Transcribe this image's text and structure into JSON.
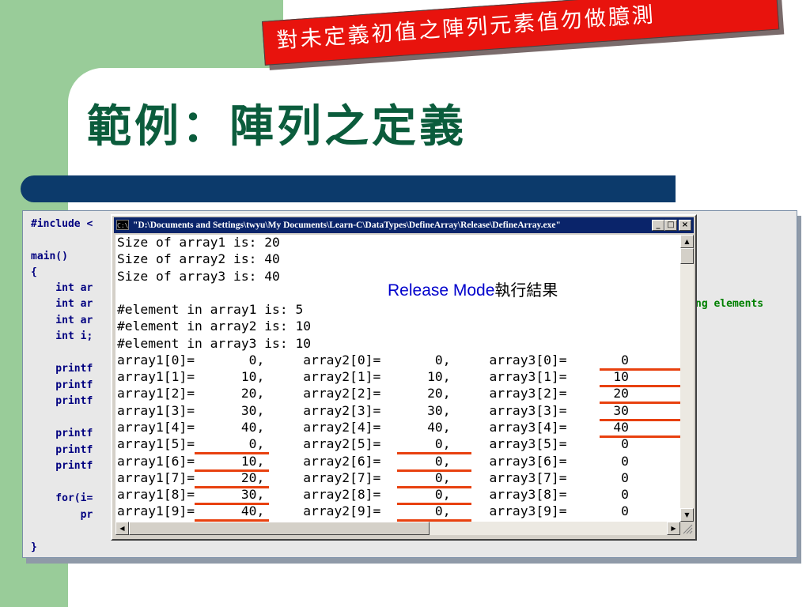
{
  "slide": {
    "title": "範例：陣列之定義",
    "callout": "對未定義初值之陣列元素值勿做臆測",
    "colors": {
      "green_bar": "#99cc99",
      "title_text": "#0b5c3c",
      "blue_bar": "#0c3a6b",
      "callout_bg": "#e8130d",
      "underline": "#e8410f"
    }
  },
  "code": {
    "lines": [
      "#include <",
      "",
      "main()",
      "{",
      "    int ar",
      "    int ar",
      "    int ar",
      "    int i;",
      "",
      "    printf",
      "    printf",
      "    printf",
      "",
      "    printf",
      "    printf",
      "    printf",
      "",
      "    for(i=",
      "        pr",
      "",
      "}"
    ],
    "comment_fragment": "ng elements"
  },
  "console": {
    "title": "\"D:\\Documents and Settings\\twyu\\My Documents\\Learn-C\\DataTypes\\DefineArray\\Release\\DefineArray.exe\"",
    "icon": "console-icon",
    "buttons": {
      "minimize": "_",
      "maximize": "□",
      "close": "×"
    },
    "note": {
      "main": "Release Mode",
      "cjk": "執行結果"
    },
    "lines": [
      "Size of array1 is: 20",
      "Size of array2 is: 40",
      "Size of array3 is: 40",
      "",
      "#element in array1 is: 5",
      "#element in array2 is: 10",
      "#element in array3 is: 10",
      "array1[0]=       0,     array2[0]=       0,     array3[0]=       0",
      "array1[1]=      10,     array2[1]=      10,     array3[1]=      10",
      "array1[2]=      20,     array2[2]=      20,     array3[2]=      20",
      "array1[3]=      30,     array2[3]=      30,     array3[3]=      30",
      "array1[4]=      40,     array2[4]=      40,     array3[4]=      40",
      "array1[5]=       0,     array2[5]=       0,     array3[5]=       0",
      "array1[6]=      10,     array2[6]=       0,     array3[6]=       0",
      "array1[7]=      20,     array2[7]=       0,     array3[7]=       0",
      "array1[8]=      30,     array2[8]=       0,     array3[8]=       0",
      "array1[9]=      40,     array2[9]=       0,     array3[9]=       0"
    ],
    "scroll": {
      "up": "▲",
      "down": "▼",
      "left": "◀",
      "right": "▶"
    }
  }
}
